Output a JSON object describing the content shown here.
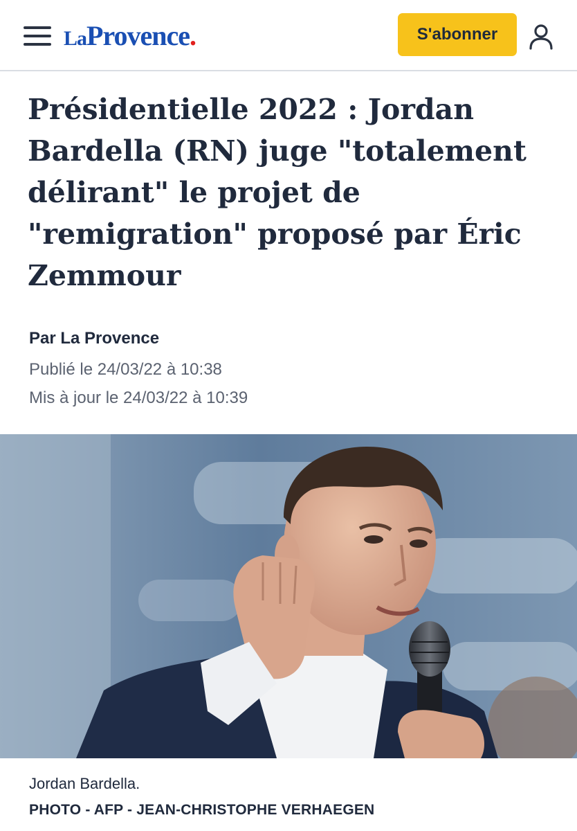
{
  "header": {
    "menu_icon": "hamburger-menu-icon",
    "logo": {
      "prefix": "La",
      "name": "Provence",
      "suffix": "."
    },
    "subscribe_label": "S'abonner",
    "account_icon": "user-account-icon",
    "colors": {
      "brand_blue": "#1a4fb3",
      "logo_dot": "#e1201d",
      "subscribe_bg": "#f7c21b"
    }
  },
  "article": {
    "title": "Présidentielle 2022 : Jordan Bardella (RN) juge \"totalement délirant\" le projet de \"remigration\" proposé par Éric Zemmour",
    "byline": "Par La Provence",
    "published": "Publié le 24/03/22 à 10:38",
    "updated": "Mis à jour le 24/03/22 à 10:39",
    "image": {
      "caption": "Jordan Bardella.",
      "credit": "PHOTO - AFP - JEAN-CHRISTOPHE VERHAEGEN"
    }
  }
}
